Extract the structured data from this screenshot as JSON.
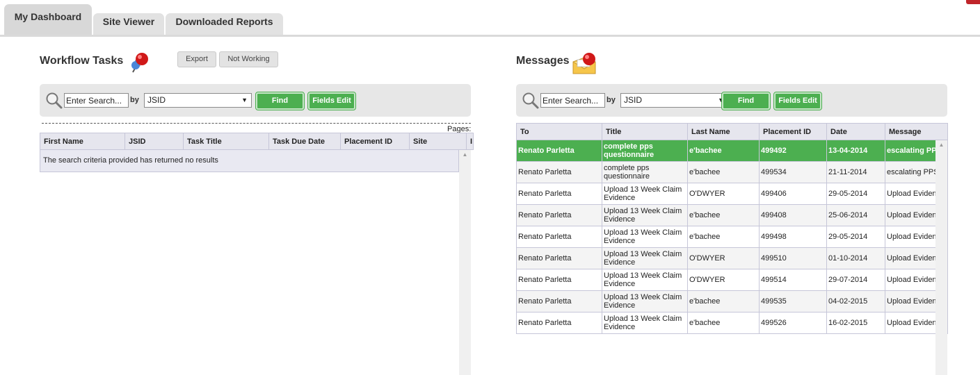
{
  "tabs": [
    {
      "label": "My Dashboard",
      "active": true
    },
    {
      "label": "Site Viewer",
      "active": false
    },
    {
      "label": "Downloaded Reports",
      "active": false
    }
  ],
  "workflow": {
    "title": "Workflow Tasks",
    "icon": "pushpin-icon",
    "export_label": "Export",
    "not_working_label": "Not Working",
    "search": {
      "placeholder": "Enter Search...",
      "by_label": "by",
      "select_value": "JSID",
      "find_label": "Find",
      "fields_edit_label": "Fields Edit"
    },
    "pages_label": "Pages:",
    "columns": [
      "First Name",
      "JSID",
      "Task Title",
      "Task Due Date",
      "Placement ID",
      "Site",
      "I"
    ],
    "empty_message": "The search criteria provided has returned no results"
  },
  "messages": {
    "title": "Messages",
    "icon": "envelope-alert-icon",
    "search": {
      "placeholder": "Enter Search...",
      "by_label": "by",
      "select_value": "JSID",
      "find_label": "Find",
      "fields_edit_label": "Fields Edit"
    },
    "columns": [
      "To",
      "Title",
      "Last Name",
      "Placement ID",
      "Date",
      "Message"
    ],
    "rows": [
      {
        "to": "Renato Parletta",
        "title": "complete pps questionnaire",
        "last_name": "e'bachee",
        "placement_id": "499492",
        "date": "13-04-2014",
        "message": "escalating PPS",
        "selected": true
      },
      {
        "to": "Renato Parletta",
        "title": "complete pps questionnaire",
        "last_name": "e'bachee",
        "placement_id": "499534",
        "date": "21-11-2014",
        "message": "escalating PPS"
      },
      {
        "to": "Renato Parletta",
        "title": "Upload 13 Week Claim Evidence",
        "last_name": "O'DWYER",
        "placement_id": "499406",
        "date": "29-05-2014",
        "message": "Upload Eviden"
      },
      {
        "to": "Renato Parletta",
        "title": "Upload 13 Week Claim Evidence",
        "last_name": "e'bachee",
        "placement_id": "499408",
        "date": "25-06-2014",
        "message": "Upload Eviden"
      },
      {
        "to": "Renato Parletta",
        "title": "Upload 13 Week Claim Evidence",
        "last_name": "e'bachee",
        "placement_id": "499498",
        "date": "29-05-2014",
        "message": "Upload Eviden"
      },
      {
        "to": "Renato Parletta",
        "title": "Upload 13 Week Claim Evidence",
        "last_name": "O'DWYER",
        "placement_id": "499510",
        "date": "01-10-2014",
        "message": "Upload Eviden"
      },
      {
        "to": "Renato Parletta",
        "title": "Upload 13 Week Claim Evidence",
        "last_name": "O'DWYER",
        "placement_id": "499514",
        "date": "29-07-2014",
        "message": "Upload Eviden"
      },
      {
        "to": "Renato Parletta",
        "title": "Upload 13 Week Claim Evidence",
        "last_name": "e'bachee",
        "placement_id": "499535",
        "date": "04-02-2015",
        "message": "Upload Eviden"
      },
      {
        "to": "Renato Parletta",
        "title": "Upload 13 Week Claim Evidence",
        "last_name": "e'bachee",
        "placement_id": "499526",
        "date": "16-02-2015",
        "message": "Upload Eviden"
      }
    ]
  },
  "colors": {
    "accent_green": "#4caf50",
    "tab_gray": "#e2e2e2",
    "header_bg": "#e6e6ee"
  }
}
